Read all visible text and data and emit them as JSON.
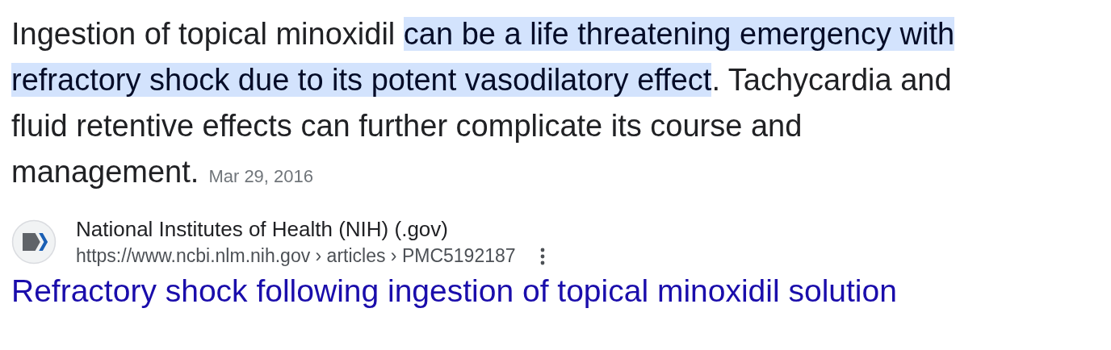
{
  "snippet": {
    "parts": [
      {
        "text": "Ingestion of topical minoxidil ",
        "highlighted": false
      },
      {
        "text": "can be a life threatening emergency with refractory shock due to its potent vasodilatory effect",
        "highlighted": true
      },
      {
        "text": ". Tachycardia and fluid retentive effects can further complicate its course and management.",
        "highlighted": false
      }
    ],
    "date": "Mar 29, 2016"
  },
  "source": {
    "site_name": "National Institutes of Health (NIH) (.gov)",
    "url": "https://www.ncbi.nlm.nih.gov › articles › PMC5192187",
    "title": "Refractory shock following ingestion of topical minoxidil solution"
  }
}
